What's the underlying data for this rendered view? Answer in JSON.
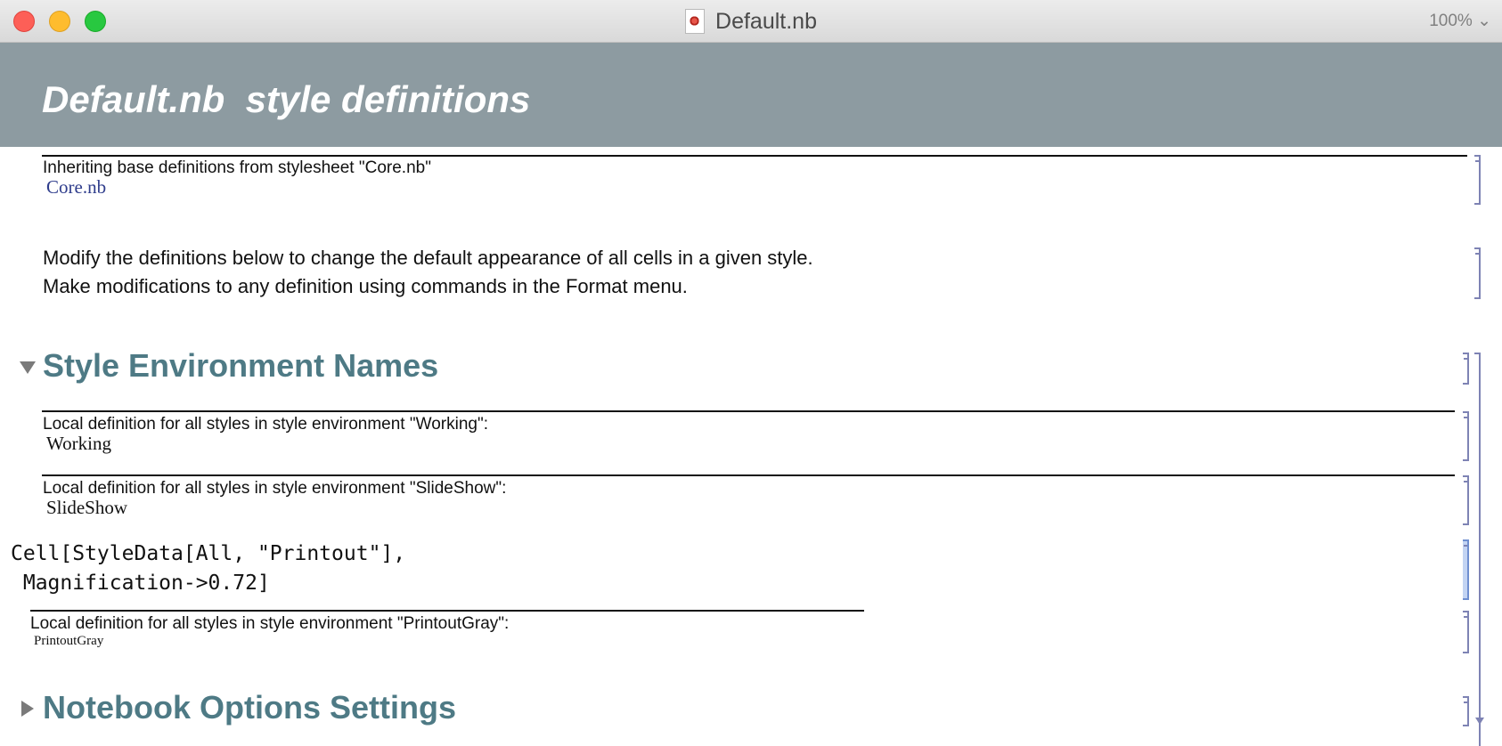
{
  "window": {
    "title": "Default.nb",
    "zoom": "100%"
  },
  "banner": {
    "title": "Default.nb  style definitions"
  },
  "stylesheet_cell": {
    "label": "Inheriting base definitions from stylesheet \"Core.nb\"",
    "value": "Core.nb"
  },
  "intro_text": {
    "line1": "Modify the definitions below to change the default appearance of all cells in a given style.",
    "line2": "Make modifications to any definition using commands in the Format menu."
  },
  "section_style_env": {
    "title": "Style Environment Names",
    "expanded": true
  },
  "env_working": {
    "label": "Local definition for all styles in style environment \"Working\":",
    "value": "Working"
  },
  "env_slideshow": {
    "label": "Local definition for all styles in style environment \"SlideShow\":",
    "value": "SlideShow"
  },
  "code_cell": {
    "line1": "Cell[StyleData[All, \"Printout\"],",
    "line2": " Magnification->0.72]"
  },
  "env_printoutgray": {
    "label": "Local definition for all styles in style environment \"PrintoutGray\":",
    "value": "PrintoutGray"
  },
  "section_notebook_options": {
    "title": "Notebook Options Settings",
    "expanded": false
  },
  "colors": {
    "banner": "#8d9ba1",
    "section_title": "#4e7a85",
    "stylesheet_link": "#2f3d8c",
    "bracket": "#7e83b4",
    "bracket_selected": "#c3d4f3"
  }
}
